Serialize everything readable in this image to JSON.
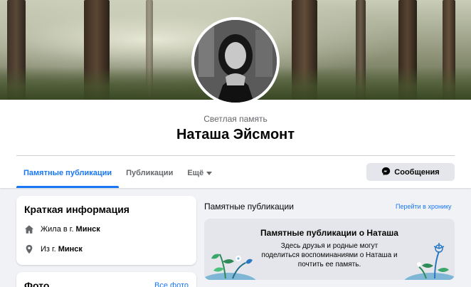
{
  "profile": {
    "memorial_label": "Светлая память",
    "name": "Наташа Эйсмонт"
  },
  "tabs": [
    {
      "label": "Памятные публикации",
      "active": true
    },
    {
      "label": "Публикации",
      "active": false
    },
    {
      "label": "Ещё",
      "active": false
    }
  ],
  "message_button": {
    "label": "Сообщения",
    "icon": "messenger-icon"
  },
  "intro": {
    "title": "Краткая информация",
    "items": [
      {
        "icon": "home-icon",
        "prefix": "Жила в г.",
        "value": "Минск"
      },
      {
        "icon": "location-pin-icon",
        "prefix": "Из г.",
        "value": "Минск"
      }
    ]
  },
  "photos": {
    "title": "Фото",
    "link": "Все фото"
  },
  "memorial_posts": {
    "section_title": "Памятные публикации",
    "timeline_link": "Перейти в хронику",
    "box_title": "Памятные публикации о Наташа",
    "box_text": "Здесь друзья и родные могут поделиться воспоминаниями о Наташа и почтить ее память."
  },
  "colors": {
    "accent": "#1877f2",
    "background": "#f0f2f5",
    "button_bg": "#e4e6eb"
  }
}
